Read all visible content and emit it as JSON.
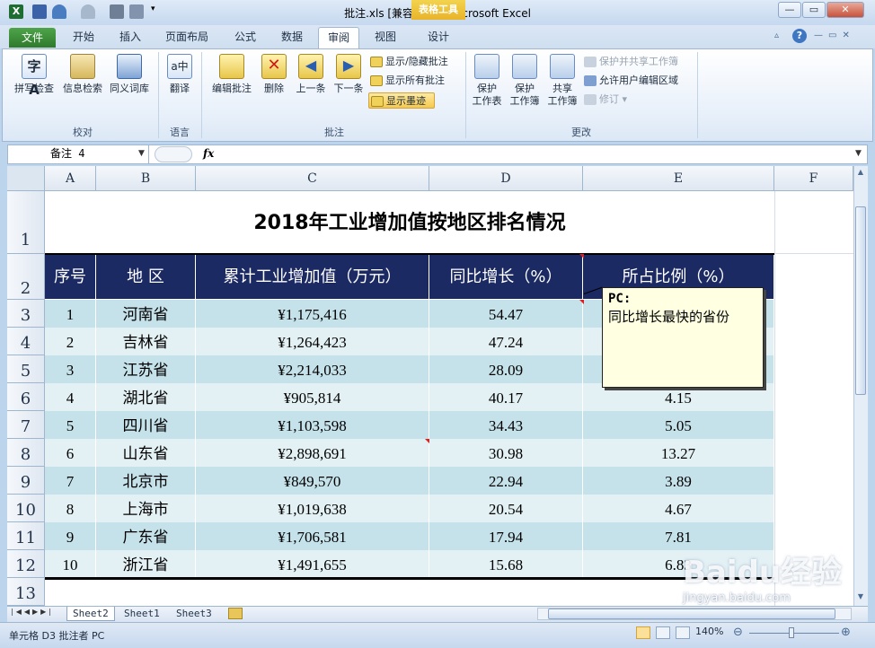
{
  "window": {
    "title": "批注.xls  [兼容模式] - Microsoft Excel",
    "context_tab": "表格工具",
    "min_label": "—",
    "max_label": "▭",
    "close_label": "✕"
  },
  "tabs": [
    {
      "label": "文件"
    },
    {
      "label": "开始"
    },
    {
      "label": "插入"
    },
    {
      "label": "页面布局"
    },
    {
      "label": "公式"
    },
    {
      "label": "数据"
    },
    {
      "label": "审阅"
    },
    {
      "label": "视图"
    },
    {
      "label": "设计"
    }
  ],
  "ribbon": {
    "groups": {
      "proofing": "校对",
      "language": "语言",
      "comments": "批注",
      "changes": "更改"
    },
    "buttons": {
      "spell": "拼写检查",
      "research": "信息检索",
      "thesaurus": "同义词库",
      "translate": "翻译",
      "edit_comment": "编辑批注",
      "delete": "删除",
      "prev": "上一条",
      "next": "下一条",
      "show_hide": "显示/隐藏批注",
      "show_all": "显示所有批注",
      "show_ink": "显示墨迹",
      "protect_sheet_1": "保护",
      "protect_sheet_2": "工作表",
      "protect_book_1": "保护",
      "protect_book_2": "工作簿",
      "share_book_1": "共享",
      "share_book_2": "工作簿",
      "protect_share": "保护并共享工作簿",
      "allow_edit": "允许用户编辑区域",
      "track": "修订"
    }
  },
  "formula_bar": {
    "name_box": "备注 4",
    "fx": "fx"
  },
  "columns": [
    "A",
    "B",
    "C",
    "D",
    "E",
    "F"
  ],
  "rows": [
    "1",
    "2",
    "3",
    "4",
    "5",
    "6",
    "7",
    "8",
    "9",
    "10",
    "11",
    "12",
    "13"
  ],
  "sheet": {
    "title": "2018年工业增加值按地区排名情况",
    "headers": [
      "序号",
      "地 区",
      "累计工业增加值（万元）",
      "同比增长（%）",
      "所占比例（%）"
    ],
    "data": [
      [
        "1",
        "河南省",
        "¥1,175,416",
        "54.47",
        ""
      ],
      [
        "2",
        "吉林省",
        "¥1,264,423",
        "47.24",
        ""
      ],
      [
        "3",
        "江苏省",
        "¥2,214,033",
        "28.09",
        ""
      ],
      [
        "4",
        "湖北省",
        "¥905,814",
        "40.17",
        "4.15"
      ],
      [
        "5",
        "四川省",
        "¥1,103,598",
        "34.43",
        "5.05"
      ],
      [
        "6",
        "山东省",
        "¥2,898,691",
        "30.98",
        "13.27"
      ],
      [
        "7",
        "北京市",
        "¥849,570",
        "22.94",
        "3.89"
      ],
      [
        "8",
        "上海市",
        "¥1,019,638",
        "20.54",
        "4.67"
      ],
      [
        "9",
        "广东省",
        "¥1,706,581",
        "17.94",
        "7.81"
      ],
      [
        "10",
        "浙江省",
        "¥1,491,655",
        "15.68",
        "6.83"
      ]
    ]
  },
  "comment": {
    "author": "PC:",
    "text": "同比增长最快的省份"
  },
  "sheet_tabs": [
    "Sheet2",
    "Sheet1",
    "Sheet3"
  ],
  "status": {
    "text": "单元格 D3 批注者 PC",
    "zoom": "140%"
  },
  "watermark": "Baidu经验",
  "watermark_url": "jingyan.baidu.com"
}
